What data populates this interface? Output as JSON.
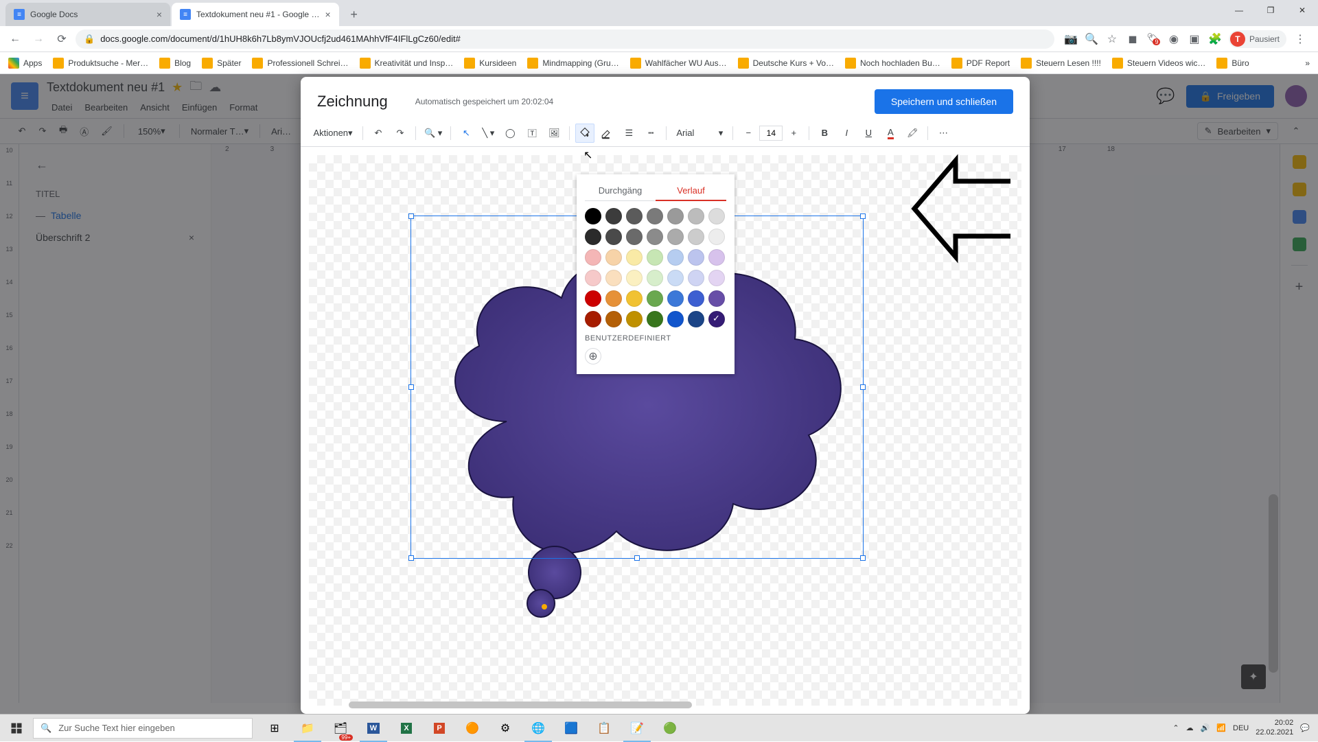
{
  "browser": {
    "tabs": [
      {
        "title": "Google Docs"
      },
      {
        "title": "Textdokument neu #1 - Google …"
      }
    ],
    "url": "docs.google.com/document/d/1hUH8k6h7Lb8ymVJOUcfj2ud461MAhhVfF4IFlLgCz60/edit#",
    "profile_label": "Pausiert",
    "profile_initial": "T"
  },
  "bookmarks": {
    "apps": "Apps",
    "items": [
      "Produktsuche - Mer…",
      "Blog",
      "Später",
      "Professionell Schrei…",
      "Kreativität und Insp…",
      "Kursideen",
      "Mindmapping  (Gru…",
      "Wahlfächer WU Aus…",
      "Deutsche Kurs + Vo…",
      "Noch hochladen Bu…",
      "PDF Report",
      "Steuern Lesen !!!!",
      "Steuern Videos wic…",
      "Büro"
    ]
  },
  "docs": {
    "title": "Textdokument neu #1",
    "menus": [
      "Datei",
      "Bearbeiten",
      "Ansicht",
      "Einfügen",
      "Format"
    ],
    "share": "Freigeben",
    "zoom": "150%",
    "style": "Normaler T…",
    "font_trunc": "Ari…",
    "edit_mode": "Bearbeiten"
  },
  "outline": {
    "title": "TITEL",
    "table": "Tabelle",
    "h2": "Überschrift 2"
  },
  "ruler_h": [
    "2",
    "3"
  ],
  "ruler_docs": [
    "17",
    "18"
  ],
  "ruler_v": [
    "10",
    "11",
    "12",
    "13",
    "14",
    "15",
    "16",
    "17",
    "18",
    "19",
    "20",
    "21",
    "22"
  ],
  "dialog": {
    "title": "Zeichnung",
    "autosave": "Automatisch gespeichert um 20:02:04",
    "save_close": "Speichern und schließen",
    "actions": "Aktionen",
    "font": "Arial",
    "font_size": "14"
  },
  "color_picker": {
    "tab_solid": "Durchgäng",
    "tab_gradient": "Verlauf",
    "custom_label": "Benutzerdefiniert",
    "rows": [
      [
        "#000000",
        "#3c3c3c",
        "#5b5b5b",
        "#7a7a7a",
        "#9a9a9a",
        "#bcbcbc",
        "#dcdcdc"
      ],
      [
        "#2b2b2b",
        "#4a4a4a",
        "#6a6a6a",
        "#8b8b8b",
        "#ababab",
        "#cccccc",
        "#ededed"
      ],
      [
        "#f4b6b6",
        "#f7d3a8",
        "#f9eaa6",
        "#c7e6b4",
        "#b6cdf0",
        "#bcc4ee",
        "#d7c2ec"
      ],
      [
        "#f6c9c9",
        "#fadfbe",
        "#fbf0c1",
        "#d7eecb",
        "#cadbf5",
        "#cfd4f3",
        "#e3d4f2"
      ],
      [
        "#cc0000",
        "#e69138",
        "#f1c232",
        "#6aa84f",
        "#3c78d8",
        "#3d5fd1",
        "#674ea7"
      ],
      [
        "#a61c00",
        "#b45f06",
        "#bf9000",
        "#38761d",
        "#1155cc",
        "#1c4587",
        "#351c75"
      ]
    ],
    "selected": [
      5,
      6
    ]
  },
  "taskbar": {
    "search_placeholder": "Zur Suche Text hier eingeben",
    "lang": "DEU",
    "time": "20:02",
    "date": "22.02.2021",
    "notif": "99+"
  }
}
